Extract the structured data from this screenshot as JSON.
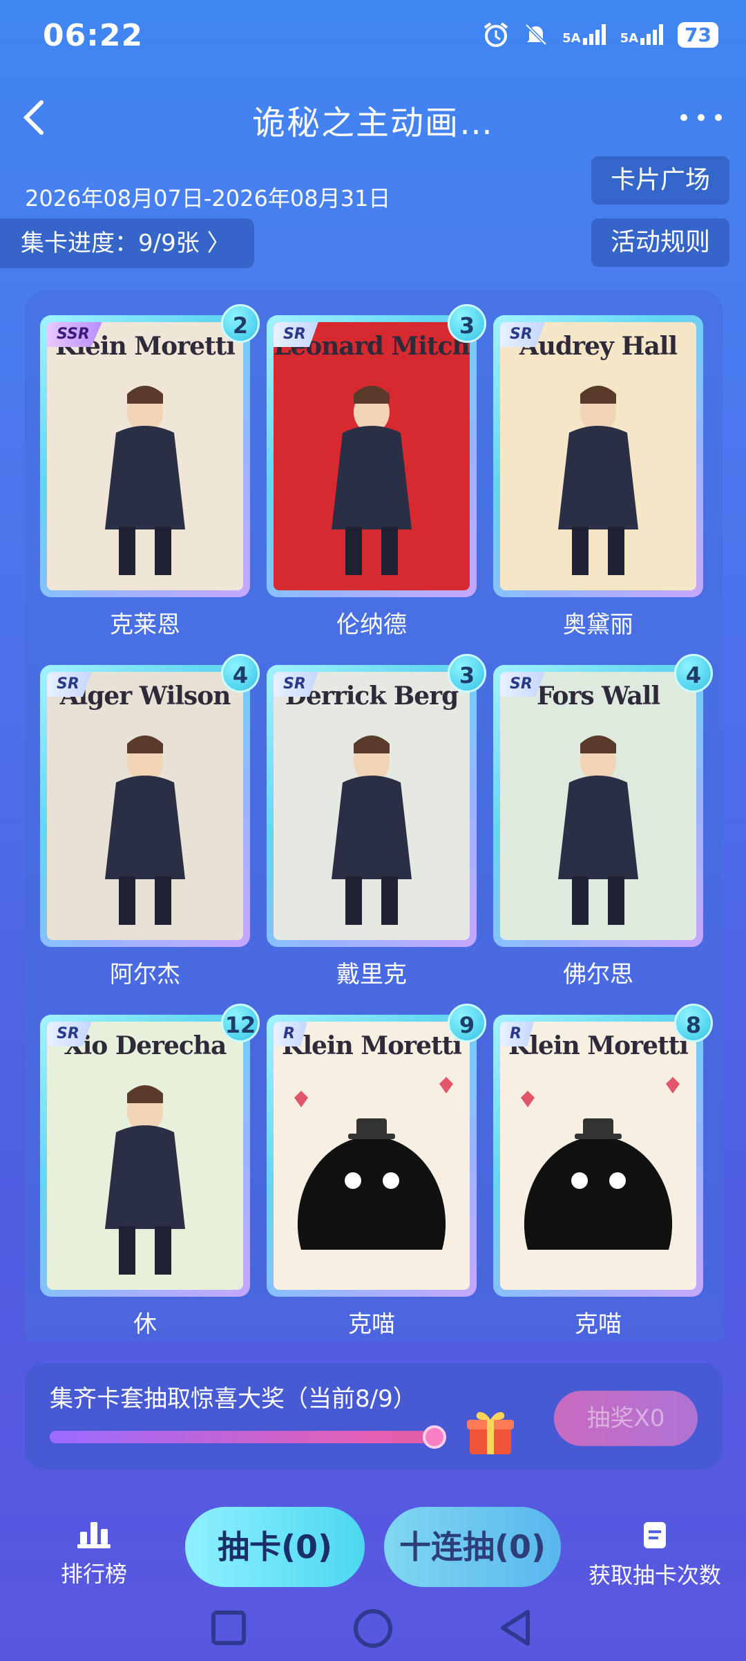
{
  "status_bar": {
    "time": "06:22",
    "sim1": "5A",
    "sim2": "5A",
    "battery": "73"
  },
  "header": {
    "title": "诡秘之主动画…"
  },
  "event": {
    "date_range": "2026年08月07日-2026年08月31日",
    "progress_label": "集卡进度：9/9张 〉",
    "plaza_label": "卡片广场",
    "rules_label": "活动规则"
  },
  "cards": [
    {
      "name": "克莱恩",
      "rarity": "SSR",
      "count": "2",
      "title": "Klein Moretti",
      "art": "#efe6d8"
    },
    {
      "name": "伦纳德",
      "rarity": "SR",
      "count": "3",
      "title": "Leonard Mitchell",
      "art": "#d62a30"
    },
    {
      "name": "奥黛丽",
      "rarity": "SR",
      "count": "",
      "title": "Audrey Hall",
      "art": "#f4e6c7"
    },
    {
      "name": "阿尔杰",
      "rarity": "SR",
      "count": "4",
      "title": "Alger Wilson",
      "art": "#e8e2d6"
    },
    {
      "name": "戴里克",
      "rarity": "SR",
      "count": "3",
      "title": "Derrick Berg",
      "art": "#e6e8e2"
    },
    {
      "name": "佛尔思",
      "rarity": "SR",
      "count": "4",
      "title": "Fors Wall",
      "art": "#dfeadf"
    },
    {
      "name": "休",
      "rarity": "SR",
      "count": "12",
      "title": "Xio Derecha",
      "art": "#e6f0da"
    },
    {
      "name": "克喵",
      "rarity": "R",
      "count": "9",
      "title": "Klein Moretti",
      "art": "#f6efe2"
    },
    {
      "name": "克喵",
      "rarity": "R",
      "count": "8",
      "title": "Klein Moretti",
      "art": "#f6efe2"
    }
  ],
  "prize": {
    "text": "集齐卡套抽取惊喜大奖（当前8/9）",
    "progress": 0.89,
    "button_label": "抽奖X0"
  },
  "bottom": {
    "rank_label": "排行榜",
    "draw_label": "抽卡(0)",
    "ten_draw_label": "十连抽(0)",
    "get_draws_label": "获取抽卡次数"
  },
  "colors": {
    "accent": "#4cd7f0",
    "background": "#4a7cf0",
    "card_border": "#62d7f2"
  }
}
